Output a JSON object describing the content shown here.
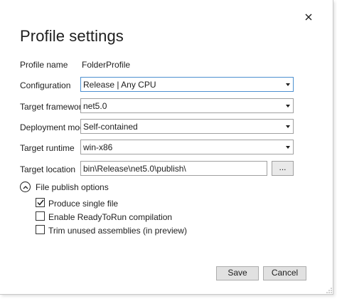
{
  "dialog": {
    "title": "Profile settings",
    "close_icon": "close-icon"
  },
  "fields": {
    "profile_name": {
      "label": "Profile name",
      "value": "FolderProfile"
    },
    "configuration": {
      "label": "Configuration",
      "value": "Release | Any CPU"
    },
    "target_framework": {
      "label": "Target framework",
      "value": "net5.0"
    },
    "deployment_mode": {
      "label": "Deployment mode",
      "value": "Self-contained"
    },
    "target_runtime": {
      "label": "Target runtime",
      "value": "win-x86"
    },
    "target_location": {
      "label": "Target location",
      "value": "bin\\Release\\net5.0\\publish\\",
      "browse_label": "..."
    }
  },
  "file_publish_options": {
    "label": "File publish options",
    "expanded": true,
    "options": [
      {
        "label": "Produce single file",
        "checked": true
      },
      {
        "label": "Enable ReadyToRun compilation",
        "checked": false
      },
      {
        "label": "Trim unused assemblies (in preview)",
        "checked": false
      }
    ]
  },
  "buttons": {
    "save": "Save",
    "cancel": "Cancel"
  },
  "colors": {
    "focus_border": "#4d90d0",
    "button_bg": "#e1e1e1"
  }
}
